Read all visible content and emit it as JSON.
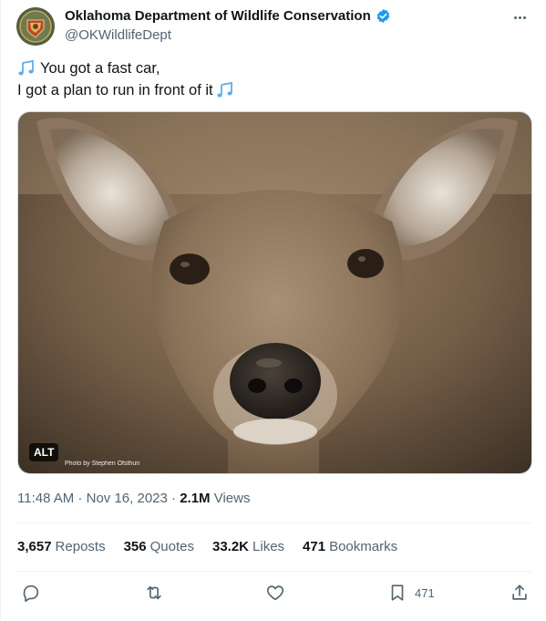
{
  "author": {
    "display_name": "Oklahoma Department of Wildlife Conservation",
    "handle": "@OKWildlifeDept"
  },
  "tweet": {
    "line1": "You got a fast car,",
    "line2": "I got a plan to run in front of it"
  },
  "media": {
    "alt_badge": "ALT",
    "photo_credit": "Photo by Stephen Ofsthun"
  },
  "meta": {
    "time": "11:48 AM",
    "separator1": " · ",
    "date": "Nov 16, 2023",
    "separator2": " · ",
    "views_count": "2.1M",
    "views_label": " Views"
  },
  "stats": {
    "reposts_count": "3,657",
    "reposts_label": "Reposts",
    "quotes_count": "356",
    "quotes_label": "Quotes",
    "likes_count": "33.2K",
    "likes_label": "Likes",
    "bookmarks_count": "471",
    "bookmarks_label": "Bookmarks"
  },
  "actions": {
    "bookmark_count": "471",
    "icons": [
      "reply-icon",
      "repost-icon",
      "like-icon",
      "bookmark-icon",
      "share-icon"
    ]
  },
  "colors": {
    "verified_blue": "#1d9bf0",
    "secondary_text": "#536471",
    "primary_text": "#0f1419"
  }
}
